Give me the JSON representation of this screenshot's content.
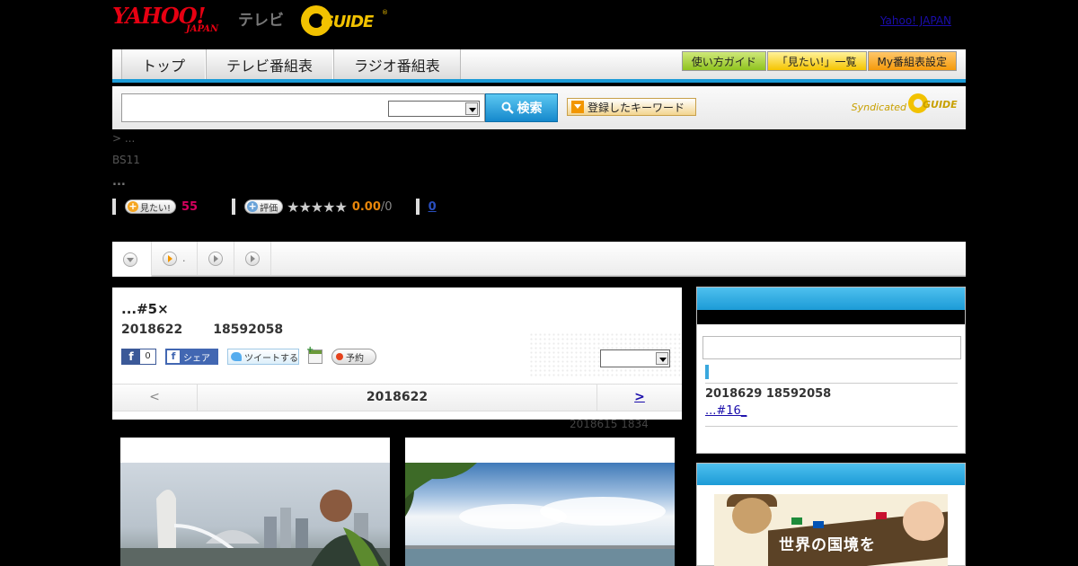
{
  "header": {
    "logo_yahoo": "YAHOO!",
    "logo_japan": "JAPAN",
    "logo_tv": "テレビ",
    "logo_gguide": "GUIDE",
    "logo_reg": "®",
    "yahoo_japan_link": "Yahoo! JAPAN",
    "brand_color": "#e60012"
  },
  "nav": {
    "tabs": [
      {
        "label": "トップ"
      },
      {
        "label": "テレビ番組表"
      },
      {
        "label": "ラジオ番組表"
      }
    ],
    "buttons": [
      {
        "label": "使い方ガイド"
      },
      {
        "label": "「見たい!」一覧"
      },
      {
        "label": "My番組表設定"
      }
    ],
    "accent_color": "#1c9bd7"
  },
  "search": {
    "input_value": "",
    "select_value": "",
    "search_label": "検索",
    "keyword_label": "登録したキーワード",
    "syndicated_label": "Syndicated",
    "syndicated_logo": "GUIDE"
  },
  "program": {
    "breadcrumb": "> ...",
    "channel": "BS11",
    "ellipsis": "...",
    "want_label": "見たい!",
    "want_count": "55",
    "rate_label": "評価",
    "stars": "★★★★★",
    "rating": "0.00",
    "rating_of": "/0",
    "comment_count": "0"
  },
  "tabstrip": {
    "tab2_text": "."
  },
  "episode": {
    "title": "...#5×",
    "date": "2018622",
    "time": "18592058",
    "fb_count": "0",
    "fb_share_label": "シェア",
    "tweet_label": "ツイートする",
    "reserve_label": "予約",
    "select_value": "",
    "pager_prev": "<",
    "pager_current": "2018622",
    "pager_next": ">",
    "updated": "2018615  1834"
  },
  "sidebar": {
    "next_date": "2018629  18592058",
    "next_link": "...#16_"
  },
  "banner": {
    "text": "世界の国境を"
  }
}
